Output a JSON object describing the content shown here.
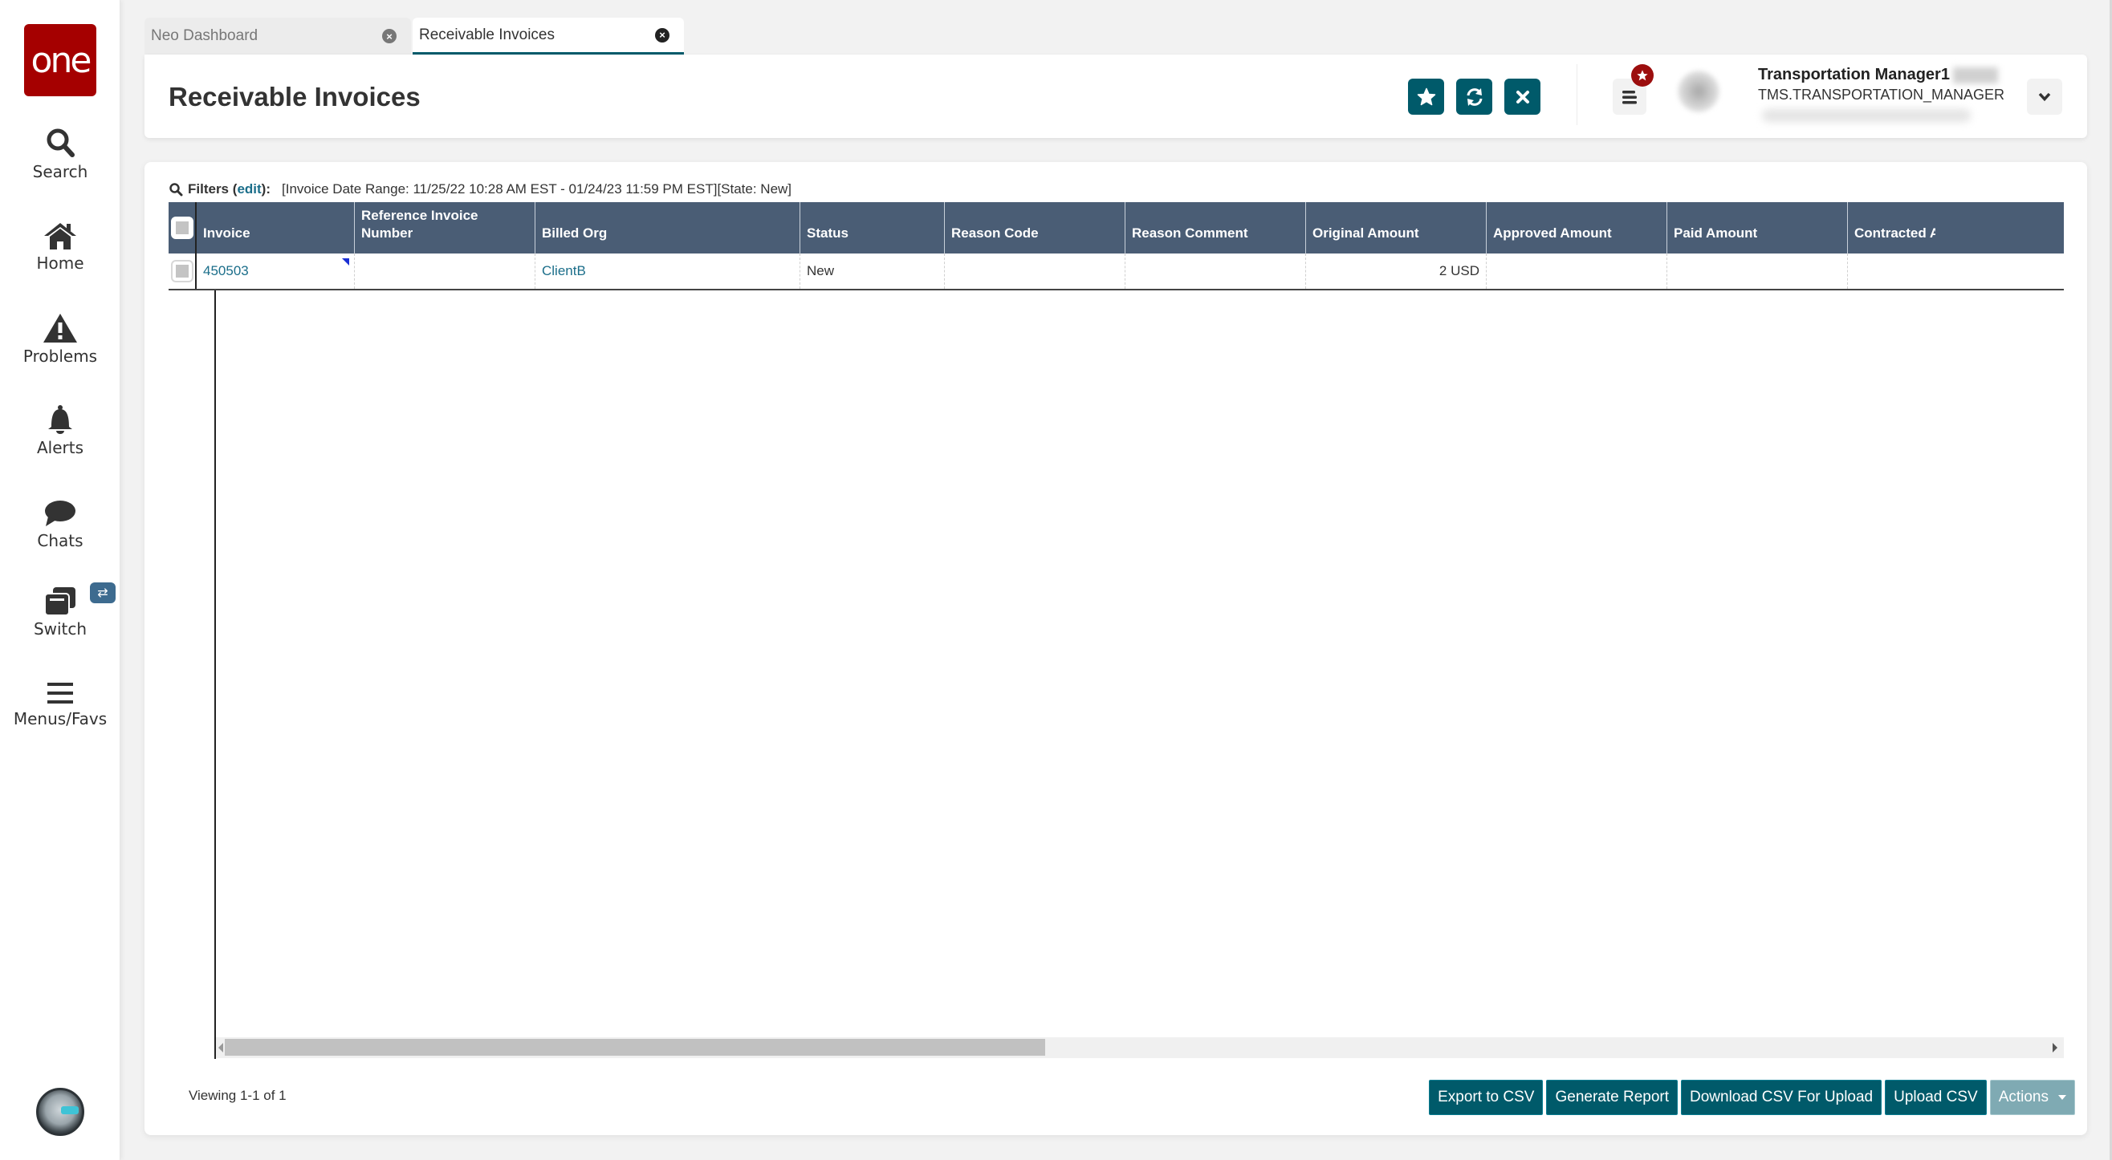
{
  "app": {
    "logo_text": "one",
    "brand_color": "#a50000",
    "accent_color": "#005a6a",
    "header_bg": "#4a5d75"
  },
  "sidebar": {
    "items": [
      {
        "label": "Search",
        "icon": "search-icon"
      },
      {
        "label": "Home",
        "icon": "home-icon"
      },
      {
        "label": "Problems",
        "icon": "warning-icon"
      },
      {
        "label": "Alerts",
        "icon": "bell-icon"
      },
      {
        "label": "Chats",
        "icon": "chat-bubble-icon"
      },
      {
        "label": "Switch",
        "icon": "switch-windows-icon",
        "badge_icon": "swap-arrows-icon"
      },
      {
        "label": "Menus/Favs",
        "icon": "hamburger-menu-icon"
      }
    ],
    "bottom_avatar": "user-avatar-robot"
  },
  "tabs": [
    {
      "label": "Neo Dashboard",
      "active": false
    },
    {
      "label": "Receivable Invoices",
      "active": true
    }
  ],
  "header": {
    "title": "Receivable Invoices",
    "buttons": [
      {
        "name": "favorite",
        "icon": "star-icon"
      },
      {
        "name": "refresh",
        "icon": "refresh-icon"
      },
      {
        "name": "close",
        "icon": "close-icon"
      }
    ],
    "user": {
      "name": "Transportation Manager1",
      "role": "TMS.TRANSPORTATION_MANAGER"
    }
  },
  "filters": {
    "label": "Filters",
    "edit_open": "(",
    "edit_label": "edit",
    "edit_close": "):",
    "value": "[Invoice Date Range: 11/25/22 10:28 AM EST - 01/24/23 11:59 PM EST][State: New]"
  },
  "table": {
    "columns": [
      "Invoice",
      "Reference Invoice Number",
      "Billed Org",
      "Status",
      "Reason Code",
      "Reason Comment",
      "Original Amount",
      "Approved Amount",
      "Paid Amount",
      "Contracted A"
    ],
    "rows": [
      {
        "invoice": "450503",
        "reference_invoice_number": "",
        "billed_org": "ClientB",
        "status": "New",
        "reason_code": "",
        "reason_comment": "",
        "original_amount": "2 USD",
        "approved_amount": "",
        "paid_amount": "",
        "contracted_amount": ""
      }
    ],
    "horizontal_scroll_fraction": 0.45
  },
  "footer": {
    "viewing": "Viewing 1-1 of 1",
    "buttons": [
      "Export to CSV",
      "Generate Report",
      "Download CSV For Upload",
      "Upload CSV"
    ],
    "actions_label": "Actions"
  }
}
